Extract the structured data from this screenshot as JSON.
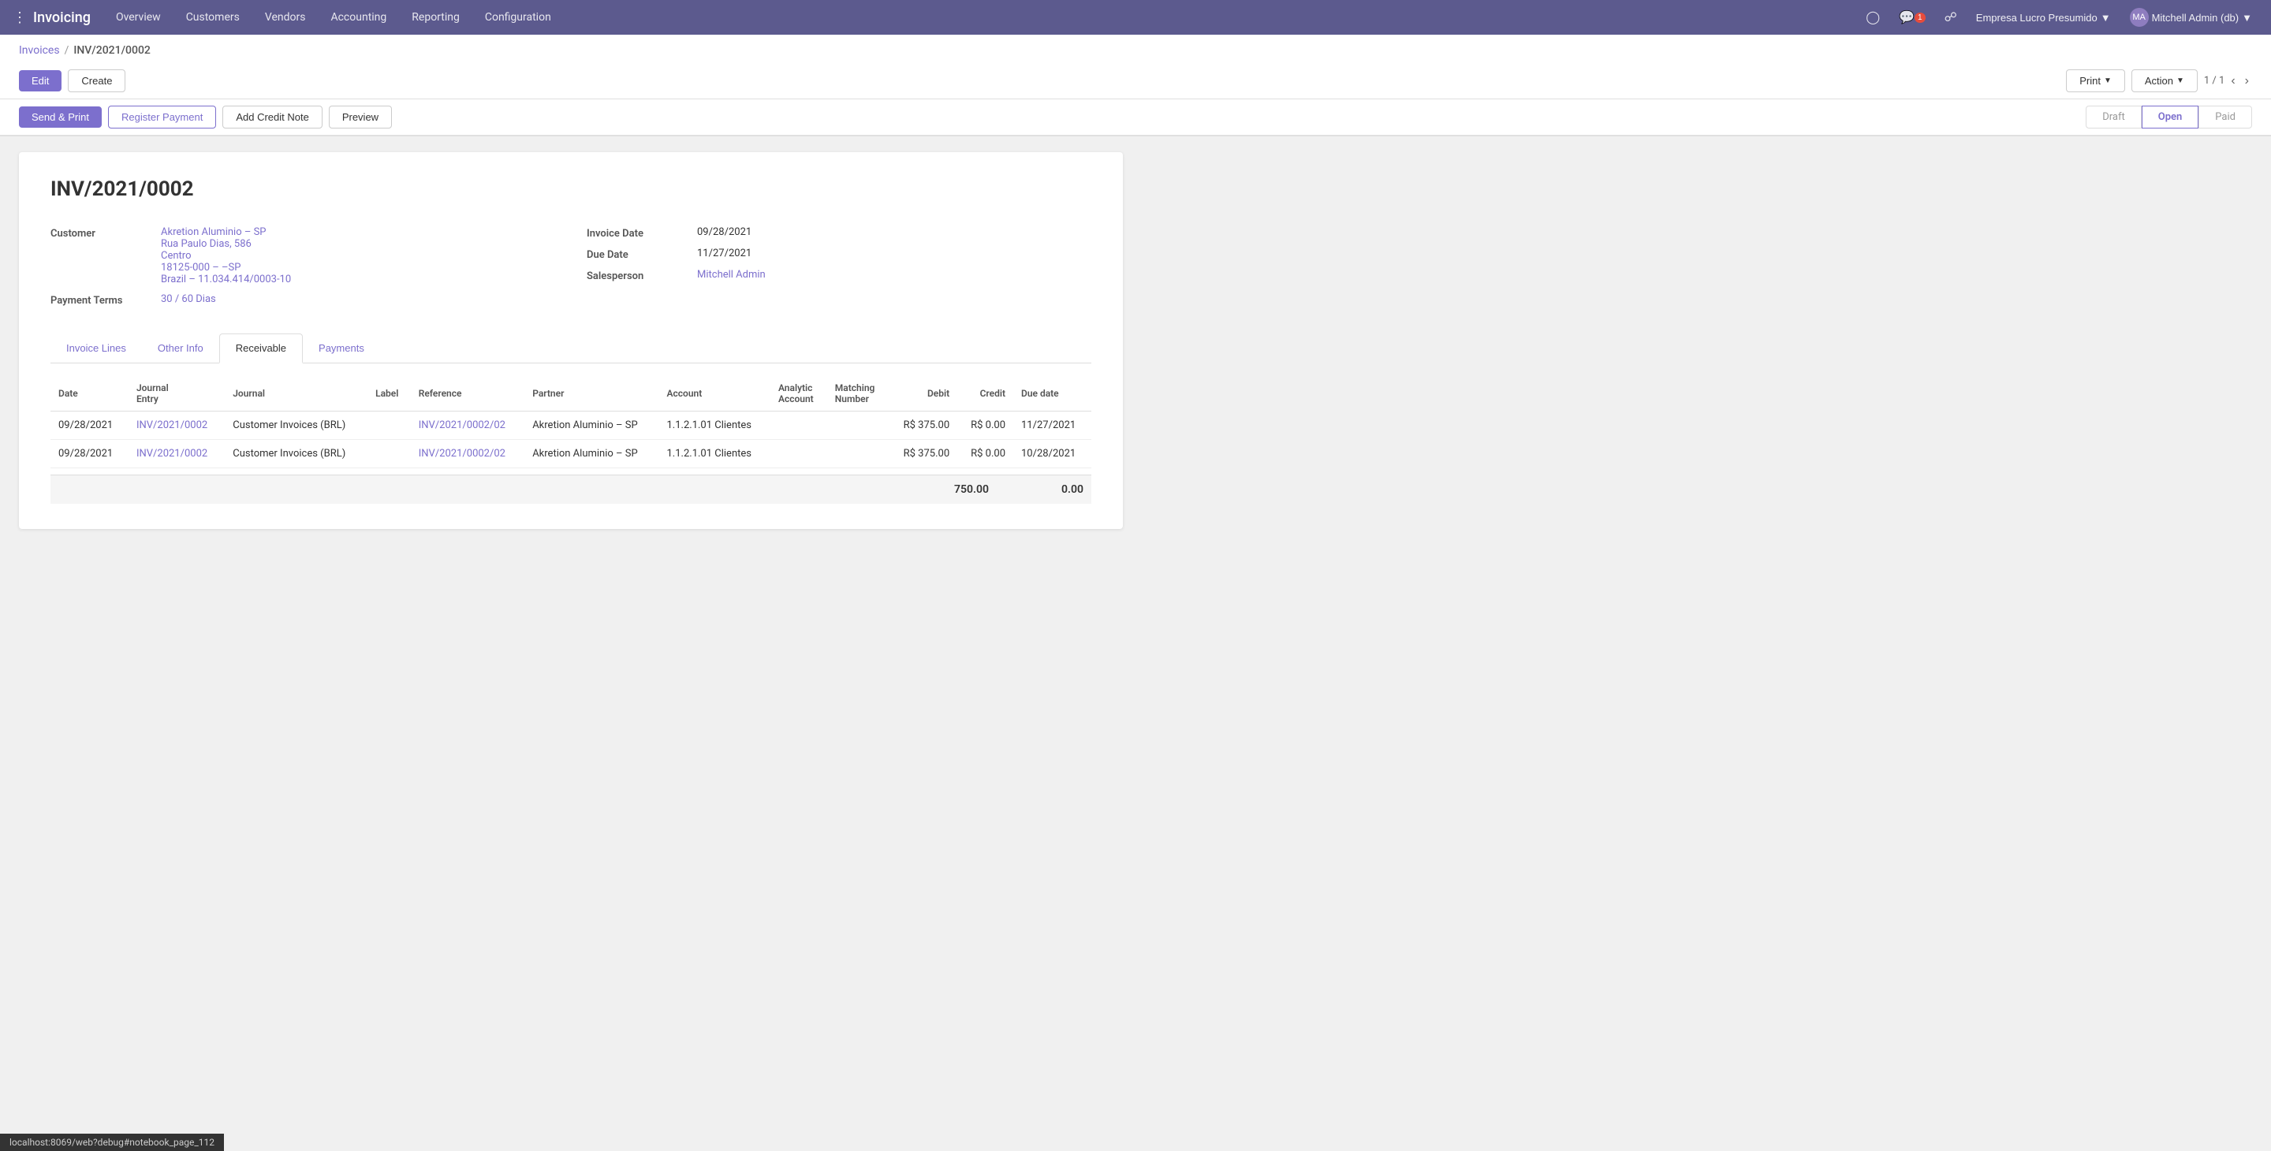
{
  "topnav": {
    "app_name": "Invoicing",
    "menu_items": [
      {
        "label": "Overview",
        "id": "overview"
      },
      {
        "label": "Customers",
        "id": "customers"
      },
      {
        "label": "Vendors",
        "id": "vendors"
      },
      {
        "label": "Accounting",
        "id": "accounting"
      },
      {
        "label": "Reporting",
        "id": "reporting"
      },
      {
        "label": "Configuration",
        "id": "configuration"
      }
    ],
    "company": "Empresa Lucro Presumido",
    "user": "Mitchell Admin (db)"
  },
  "breadcrumb": {
    "parent": "Invoices",
    "current": "INV/2021/0002"
  },
  "toolbar": {
    "edit_label": "Edit",
    "create_label": "Create",
    "print_label": "Print",
    "action_label": "Action",
    "page_info": "1 / 1"
  },
  "workflow": {
    "send_print_label": "Send & Print",
    "register_payment_label": "Register Payment",
    "add_credit_note_label": "Add Credit Note",
    "preview_label": "Preview",
    "statuses": [
      "Draft",
      "Open",
      "Paid"
    ],
    "active_status": "Open"
  },
  "invoice": {
    "number": "INV/2021/0002",
    "customer_label": "Customer",
    "customer_name": "Akretion Aluminio – SP",
    "customer_address1": "Rua Paulo Dias, 586",
    "customer_address2": "Centro",
    "customer_address3": "18125-000 – –SP",
    "customer_address4": "Brazil – 11.034.414/0003-10",
    "payment_terms_label": "Payment Terms",
    "payment_terms": "30 / 60 Dias",
    "invoice_date_label": "Invoice Date",
    "invoice_date": "09/28/2021",
    "due_date_label": "Due Date",
    "due_date": "11/27/2021",
    "salesperson_label": "Salesperson",
    "salesperson": "Mitchell Admin"
  },
  "tabs": [
    {
      "label": "Invoice Lines",
      "id": "invoice-lines"
    },
    {
      "label": "Other Info",
      "id": "other-info"
    },
    {
      "label": "Receivable",
      "id": "receivable",
      "active": true
    },
    {
      "label": "Payments",
      "id": "payments"
    }
  ],
  "table": {
    "headers": [
      "Date",
      "Journal Entry",
      "Journal",
      "Label",
      "Reference",
      "Partner",
      "Account",
      "Analytic Account",
      "Matching Number",
      "Debit",
      "Credit",
      "Due date"
    ],
    "rows": [
      {
        "date": "09/28/2021",
        "journal_entry": "INV/2021/0002",
        "journal": "Customer Invoices (BRL)",
        "label": "",
        "reference": "INV/2021/0002/02",
        "partner": "Akretion Aluminio – SP",
        "account": "1.1.2.1.01 Clientes",
        "analytic_account": "",
        "matching_number": "",
        "debit": "R$ 375.00",
        "credit": "R$ 0.00",
        "due_date": "11/27/2021"
      },
      {
        "date": "09/28/2021",
        "journal_entry": "INV/2021/0002",
        "journal": "Customer Invoices (BRL)",
        "label": "",
        "reference": "INV/2021/0002/02",
        "partner": "Akretion Aluminio – SP",
        "account": "1.1.2.1.01 Clientes",
        "analytic_account": "",
        "matching_number": "",
        "debit": "R$ 375.00",
        "credit": "R$ 0.00",
        "due_date": "10/28/2021"
      }
    ],
    "total_debit": "750.00",
    "total_credit": "0.00"
  },
  "statusbar": {
    "url": "localhost:8069/web?debug#notebook_page_112"
  }
}
